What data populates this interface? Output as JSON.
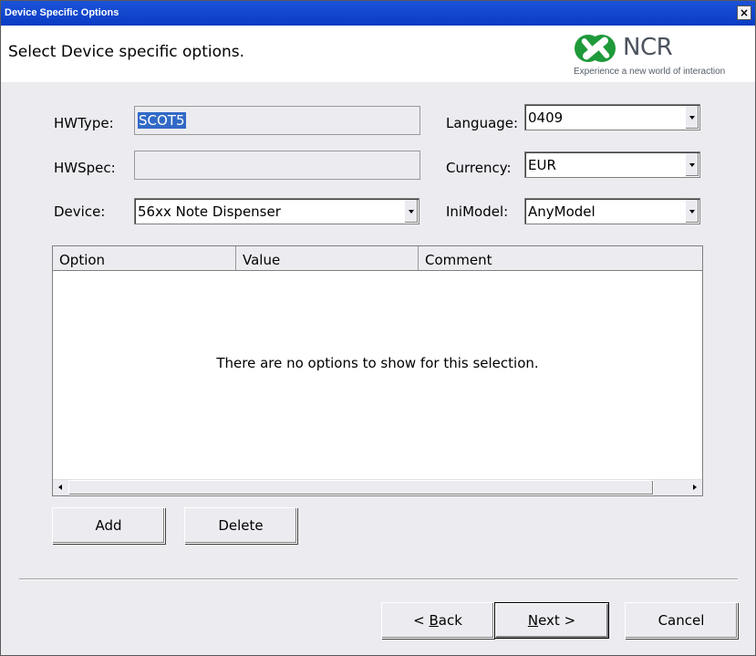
{
  "window": {
    "title": "Device Specific Options",
    "close_glyph": "×"
  },
  "header": {
    "text": "Select Device specific options.",
    "logo": {
      "word": "NCR",
      "tagline": "Experience a new world of interaction",
      "colors": {
        "green": "#1f9a3a",
        "gray": "#4b535e"
      }
    }
  },
  "form": {
    "hwtype": {
      "label": "HWType:",
      "value": "SCOT5"
    },
    "hwspec": {
      "label": "HWSpec:",
      "value": ""
    },
    "device": {
      "label": "Device:",
      "value": "56xx Note Dispenser"
    },
    "language": {
      "label": "Language:",
      "value": "0409"
    },
    "currency": {
      "label": "Currency:",
      "value": "EUR"
    },
    "inimodel": {
      "label": "IniModel:",
      "value": "AnyModel"
    }
  },
  "options_table": {
    "columns": [
      "Option",
      "Value",
      "Comment"
    ],
    "empty_message": "There are no options to show for this selection."
  },
  "buttons": {
    "add": "Add",
    "delete": "Delete",
    "back_prefix": "< ",
    "back_mnemonic": "B",
    "back_rest": "ack",
    "next_mnemonic": "N",
    "next_rest": "ext >",
    "cancel": "Cancel"
  },
  "colors": {
    "titlebar": "#0a3cc4",
    "selection": "#3169c6",
    "dialog_bg": "#ecebf0"
  }
}
